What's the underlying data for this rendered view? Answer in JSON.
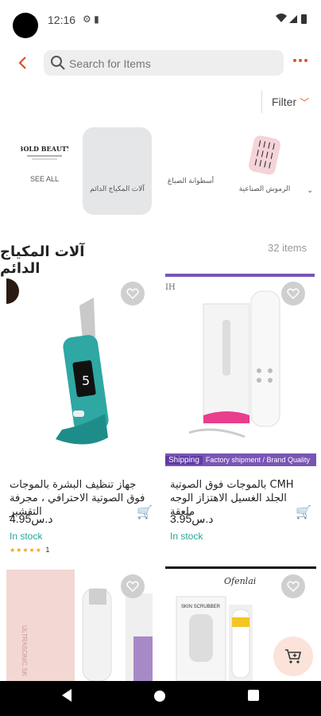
{
  "status_bar": {
    "time": "12:16"
  },
  "search": {
    "placeholder": "Search for Items"
  },
  "filter": {
    "label": "Filter"
  },
  "categories": [
    {
      "label": "SEE ALL",
      "logo_text": "BOLD BEAUTY"
    },
    {
      "label": "آلات المكياج الدائم"
    },
    {
      "label": "أسطوانة الصباغ"
    },
    {
      "label": "الرموش الصناعية"
    }
  ],
  "section": {
    "title": "آلات المكياج الدائم",
    "count": "32 items"
  },
  "products": [
    {
      "name": "جهاز تنظيف البشرة بالموجات فوق الصوتية الاحترافي ، مجرفة التقشير",
      "price": "4.95د.س",
      "stock": "In stock",
      "rating_count": "1"
    },
    {
      "name": "CMH بالموجات فوق الصوتية الجلد الغسيل الاهتزاز الوجه ملعقة",
      "price": "3.95د.س",
      "stock": "In stock",
      "brand_mark": "IH",
      "shipping_tag": "Shipping",
      "shipping_text": "Factory shipment / Brand Quality Ass"
    },
    {
      "brand_mark": "ULTRASONIC SK"
    },
    {
      "brand_mark": "Ofenlai",
      "box_text": "SKIN SCRUBBER"
    }
  ],
  "icons": {
    "back": "chevron-left-icon",
    "more": "more-dots-icon",
    "cart": "add-to-cart-icon",
    "heart": "heart-outline-icon"
  },
  "colors": {
    "accent": "#e2512a",
    "stock": "#25a89a",
    "shipping": "#7a55b5"
  }
}
